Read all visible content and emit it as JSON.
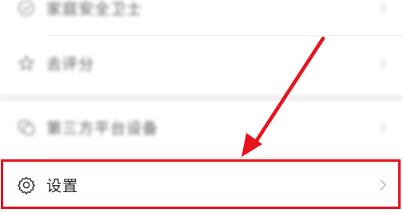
{
  "menu": {
    "items": [
      {
        "label": "家庭安全卫士",
        "icon": "shield-icon",
        "blurred": true
      },
      {
        "label": "去评分",
        "icon": "star-icon",
        "blurred": true
      },
      {
        "label": "第三方平台设备",
        "icon": "devices-icon",
        "blurred": true
      },
      {
        "label": "设置",
        "icon": "gear-icon",
        "blurred": false
      }
    ]
  },
  "annotation": {
    "highlight_color": "#e8131c",
    "highlighted_item": "设置"
  }
}
